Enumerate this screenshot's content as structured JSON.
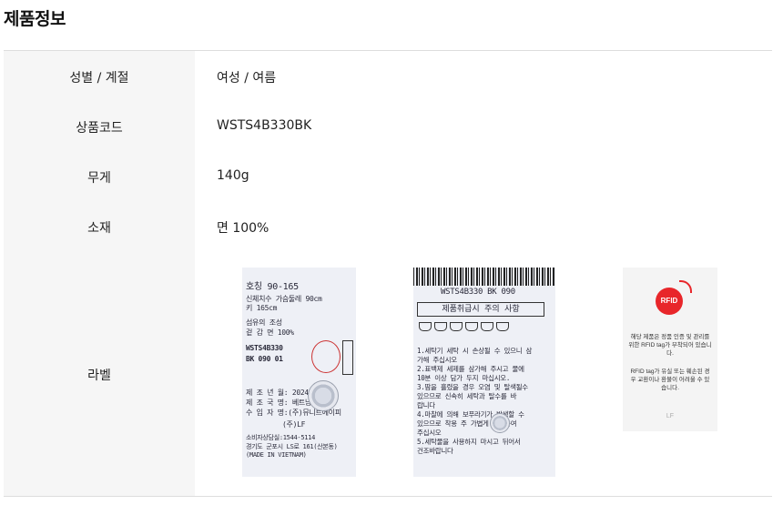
{
  "page_title": "제품정보",
  "rows": [
    {
      "label": "성별 / 계절",
      "value": "여성 / 여름"
    },
    {
      "label": "상품코드",
      "value": "WSTS4B330BK"
    },
    {
      "label": "무게",
      "value": "140g"
    },
    {
      "label": "소재",
      "value": "면 100%"
    },
    {
      "label": "라벨"
    }
  ],
  "label_images": {
    "size_label": {
      "lines": [
        "호칭  90-165",
        "신체치수 가슴둘레   90cm",
        "          키        165cm",
        "섬유의 조성",
        "겉 감         면     100%",
        "WSTS4B330",
        "BK 090 01",
        "제 조 년 월: 2024. 06",
        "제 조 국 명: 베트남",
        "수 입 자 명:(주)뮤니트에이피",
        "(주)LF",
        "소비자상담실:1544-5114",
        "경기도 군포시 LS로 161(산본동)",
        "(MADE IN VIETNAM)"
      ]
    },
    "care_label": {
      "header_code": "WSTS4B330 BK 090",
      "box_title": "제품취급시 주의 사항",
      "lines": [
        "1.세탁기 세탁 시 손상될 수 있으니 삼",
        "  가해 주십시오",
        "2.표백제 세제를 삼가해 주시고 물에",
        "  10분 이상 담가 두지 마십시오.",
        "3.땀을 흘렸을 경우 오염 및 탈색될수",
        "  있으므로 신속히 세탁과 탈수를 바",
        "  랍니다",
        "4.마찰에 의해 보푸라기가 발생할 수",
        "  있으므로 착용 주 가볍게 손질하여",
        "  주십시오",
        "5.세탁물을 사용하지 마시고 뒤어서",
        "  건조바랍니다"
      ]
    },
    "rfid_card": {
      "icon_text": "RFID",
      "text1": "해당 제품은 정품 인증 및 관리를 위한 RFID tag가 부착되어 있습니다.",
      "text2": "RFID tag가 유실 또는 훼손된 경우 교환이나 환불이 어려울 수 있습니다.",
      "logo": "LF"
    }
  }
}
